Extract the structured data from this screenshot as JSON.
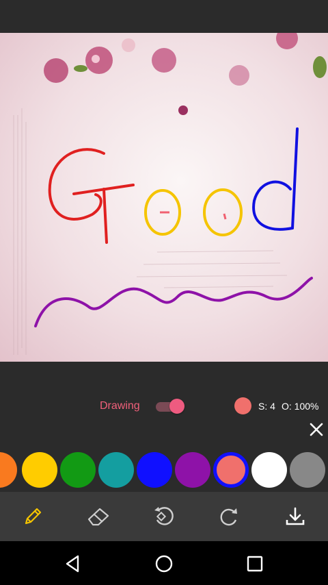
{
  "drawing_label": "Drawing",
  "drawing_enabled": true,
  "current_color": "#f0706c",
  "size_label": "S: 4",
  "opacity_label": "O: 100%",
  "canvas_text": "Good",
  "palette": [
    "#f97a1f",
    "#ffcc00",
    "#129a14",
    "#149ea0",
    "#1010ff",
    "#8e12a8",
    "#f0706c",
    "#ffffff",
    "#888888"
  ],
  "selected_color": "#f0706c",
  "tools": [
    "pencil-icon",
    "eraser-icon",
    "undo-icon",
    "redo-icon",
    "download-icon"
  ],
  "nav": [
    "back-icon",
    "home-icon",
    "recents-icon"
  ]
}
